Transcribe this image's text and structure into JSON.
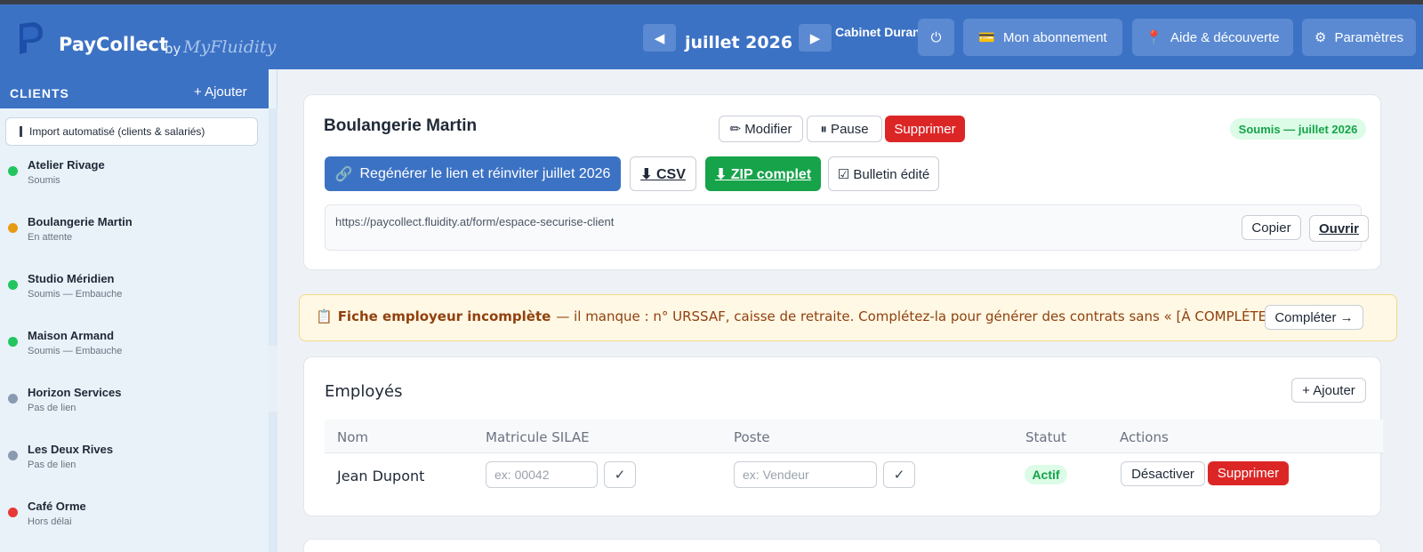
{
  "header": {
    "brand": "PayCollect",
    "brand_by": "by",
    "brand_sub": "MyFluidity",
    "prev_icon": "◀",
    "next_icon": "▶",
    "month": "juillet 2026",
    "cabinet": "Cabinet Durand",
    "power_icon": "⏻",
    "subscription_icon": "💳",
    "subscription_label": "Mon abonnement",
    "help_icon": "📍",
    "help_label": "Aide & découverte",
    "settings_icon": "⚙",
    "settings_label": "Paramètres",
    "colors": {
      "header_bg": "#3c72c4",
      "button_bg": "#5b8ad2"
    }
  },
  "sidebar": {
    "title": "CLIENTS",
    "add_label": "+ Ajouter",
    "import_label": "Import automatisé (clients & salariés)",
    "clients": [
      {
        "name": "Atelier Rivage",
        "status": "Soumis",
        "dot_color": "#22c55e"
      },
      {
        "name": "Boulangerie Martin",
        "status": "En attente",
        "dot_color": "#e69b12"
      },
      {
        "name": "Studio Méridien",
        "status": "Soumis — Embauche",
        "dot_color": "#22c55e"
      },
      {
        "name": "Maison Armand",
        "status": "Soumis — Embauche",
        "dot_color": "#22c55e"
      },
      {
        "name": "Horizon Services",
        "status": "Pas de lien",
        "dot_color": "#8a9ab0"
      },
      {
        "name": "Les Deux Rives",
        "status": "Pas de lien",
        "dot_color": "#8a9ab0"
      },
      {
        "name": "Café Orme",
        "status": "Hors délai",
        "dot_color": "#e53935"
      }
    ]
  },
  "client_card": {
    "title": "Boulangerie Martin",
    "modify_label": "✏ Modifier",
    "pause_label": "⏸ Pause",
    "delete_label": "Supprimer",
    "status_badge": "Soumis — juillet 2026",
    "regen_icon": "🔗",
    "regen_label": "Regénérer le lien et réinviter juillet 2026",
    "csv_label": "⬇ CSV",
    "zip_label": "⬇ ZIP complet",
    "bulletin_label": "☑ Bulletin édité",
    "url": "https://paycollect.fluidity.at/form/espace-securise-client",
    "copy_label": "Copier",
    "open_label": "Ouvrir"
  },
  "warning": {
    "icon": "📋",
    "title": "Fiche employeur incomplète",
    "message": "— il manque : n° URSSAF, caisse de retraite. Complétez-la pour générer des contrats sans « [À COMPLÉTER] ».",
    "button_label": "Compléter →"
  },
  "employees": {
    "title": "Employés",
    "add_label": "+ Ajouter",
    "columns": [
      "Nom",
      "Matricule SILAE",
      "Poste",
      "Statut",
      "Actions"
    ],
    "rows": [
      {
        "name": "Jean Dupont",
        "matricule_placeholder": "ex: 00042",
        "poste_placeholder": "ex: Vendeur",
        "confirm_icon": "✓",
        "status": "Actif",
        "deactivate_label": "Désactiver",
        "delete_label": "Supprimer"
      }
    ]
  }
}
